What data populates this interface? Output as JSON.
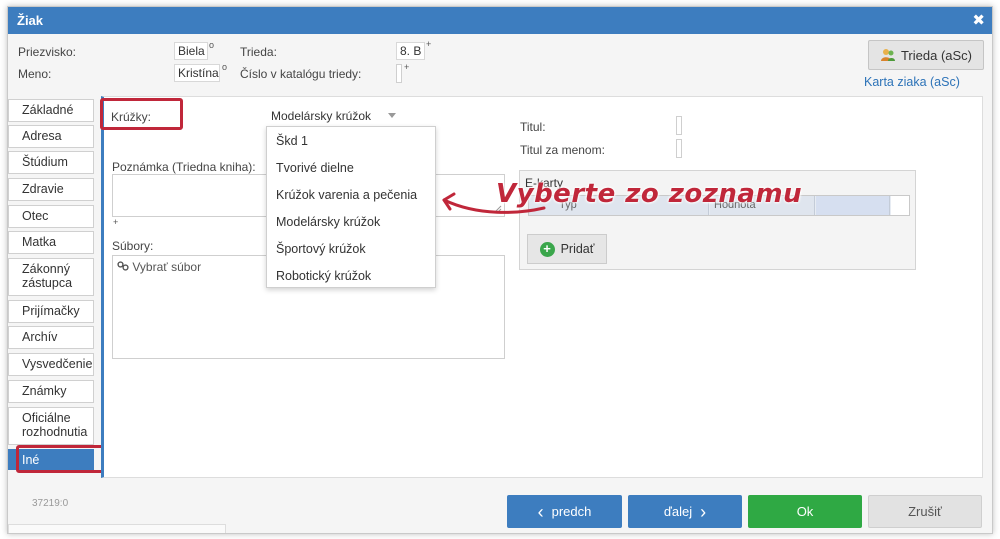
{
  "window": {
    "title": "Žiak",
    "close_glyph": "✖"
  },
  "student": {
    "priezvisko_label": "Priezvisko:",
    "priezvisko_value": "Biela",
    "priezvisko_marker": "o",
    "meno_label": "Meno:",
    "meno_value": "Kristína",
    "meno_marker": "o",
    "trieda_label": "Trieda:",
    "trieda_value": "8. B",
    "trieda_marker": "+",
    "cislo_label": "Číslo v katalógu triedy:",
    "cislo_marker": "+"
  },
  "header_actions": {
    "trieda_button": "Trieda (aSc)",
    "karta_link": "Karta ziaka (aSc)"
  },
  "tabs": [
    "Základné",
    "Adresa",
    "Štúdium",
    "Zdravie",
    "Otec",
    "Matka",
    "Zákonný zástupca",
    "Prijímačky",
    "Archív",
    "Vysvedčenie",
    "Známky",
    "Oficiálne rozhodnutia",
    "Iné"
  ],
  "active_tab": "Iné",
  "form": {
    "kruzky_label": "Krúžky:",
    "kruzky_selected": "Modelársky krúžok",
    "kruzky_options": [
      "Škd 1",
      "Tvorivé dielne",
      "Krúžok varenia a pečenia",
      "Modelársky krúžok",
      "Športový krúžok",
      "Robotický krúžok"
    ],
    "poznamka_label": "Poznámka (Triedna kniha):",
    "poznamka_marker": "+",
    "subory_label": "Súbory:",
    "vybrat_subor": "Vybrať súbor",
    "titul_label": "Titul:",
    "titul_za_menom_label": "Titul za menom:",
    "ekarty_legend": "E-karty",
    "ekarty_col_typ": "Typ",
    "ekarty_col_hodnota": "Hodnota",
    "pridat_button": "Pridať"
  },
  "annotation": "Vyberte zo zoznamu",
  "footer": {
    "record_id": "37219:0",
    "prev_button": "predch",
    "next_button": "ďalej",
    "ok_button": "Ok",
    "cancel_button": "Zrušiť"
  },
  "colors": {
    "accent": "#3d7dbf",
    "highlight": "#c0273a",
    "ok": "#2fa944"
  }
}
